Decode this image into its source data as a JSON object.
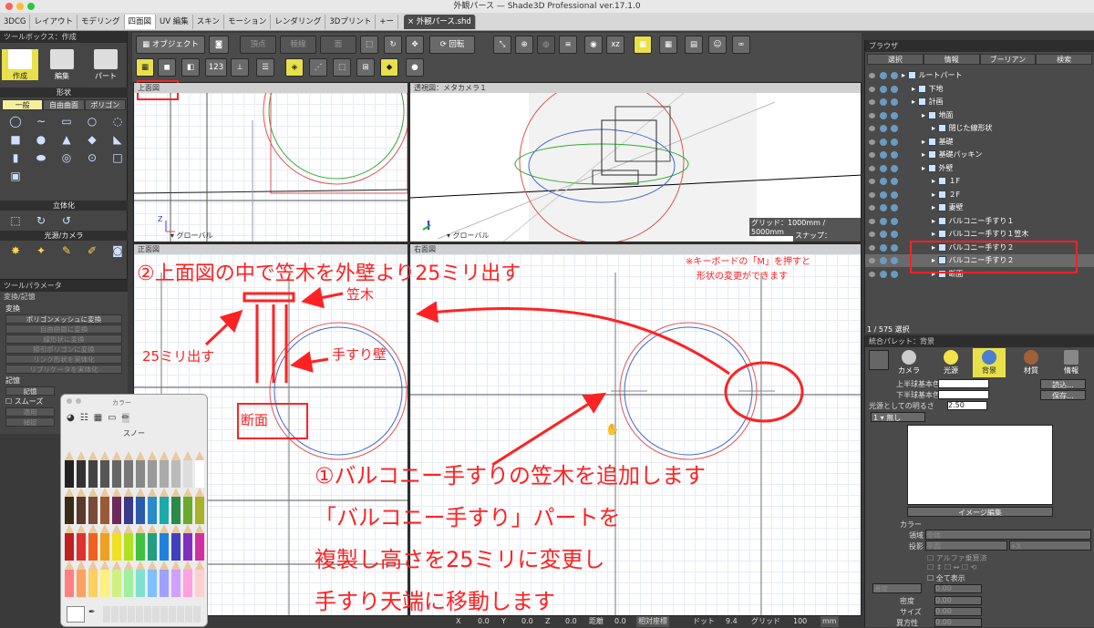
{
  "window_title": "外観パース — Shade3D Professional ver.17.1.0",
  "tabs": [
    "3DCG",
    "レイアウト",
    "モデリング",
    "四面図",
    "UV 編集",
    "スキン",
    "モーション",
    "レンダリング",
    "3Dプリント",
    "+ー"
  ],
  "active_tab_index": 3,
  "doc_tab": "× 外観パース.shd",
  "toolbox": {
    "title": "ツールボックス：作成",
    "modes": [
      "作成",
      "編集",
      "パート"
    ],
    "shape_header": "形状",
    "shape_tabs": [
      "一般",
      "自由曲面",
      "ポリゴン"
    ],
    "solid_header": "立体化",
    "light_header": "光源/カメラ"
  },
  "toolparam": {
    "title": "ツールパラメータ",
    "sub": "変換/記憶",
    "conv_label": "変換",
    "buttons": [
      "ポリゴンメッシュに変換",
      "自由曲面に変換",
      "線形状に変換",
      "掃引ポリゴンに変換",
      "リンク形状を実体化",
      "リプリケータを実体化"
    ],
    "memory_label": "記憶",
    "memory_btn": "記憶",
    "smooth": "スムーズ",
    "apply": "適用",
    "capture": "捕捉"
  },
  "toolbar": {
    "object": "オブジェクト",
    "vertex": "頂点",
    "edge": "稜線",
    "face": "面",
    "rotate": "回転"
  },
  "viewports": {
    "top": "上面図",
    "persp": "透視図：メタカメラ１",
    "front": "正面図",
    "right": "右面図",
    "global": "グローバル",
    "grid_info": "グリッド：1000mm / 5000mm",
    "snap_info": "スナップ：500mm",
    "axis_z": "Z",
    "axis_x": "X"
  },
  "browser": {
    "title": "ブラウザ",
    "tabs": [
      "選択",
      "情報",
      "ブーリアン",
      "検索"
    ],
    "tree": [
      {
        "label": "ルートパート",
        "depth": 0
      },
      {
        "label": "下地",
        "depth": 1
      },
      {
        "label": "計画",
        "depth": 1
      },
      {
        "label": "地面",
        "depth": 2
      },
      {
        "label": "閉じた線形状",
        "depth": 3
      },
      {
        "label": "基礎",
        "depth": 2
      },
      {
        "label": "基礎パッキン",
        "depth": 2
      },
      {
        "label": "外壁",
        "depth": 2
      },
      {
        "label": "１F",
        "depth": 3
      },
      {
        "label": "２F",
        "depth": 3
      },
      {
        "label": "妻壁",
        "depth": 3
      },
      {
        "label": "バルコニー手すり１",
        "depth": 3
      },
      {
        "label": "バルコニー手すり１笠木",
        "depth": 3
      },
      {
        "label": "バルコニー手すり２",
        "depth": 3
      },
      {
        "label": "バルコニー手すり２",
        "depth": 3
      },
      {
        "label": "断面",
        "depth": 3
      }
    ],
    "selection_count": "1 / 575 選択"
  },
  "palette": {
    "title": "統合パレット：背景",
    "tabs": [
      "カメラ",
      "光源",
      "背景",
      "材質",
      "情報"
    ],
    "upper": "上半球基本色",
    "lower": "下半球基本色",
    "load": "読込...",
    "save": "保存...",
    "brightness_label": "光源としての明るさ",
    "brightness": "2.50",
    "none": "無し",
    "image_edit": "イメージ編集",
    "color": "カラー",
    "area": "領域",
    "area_val": "全体",
    "projection": "投影",
    "proj_val": "平面",
    "proj_axis": "+X",
    "alpha": "アルファ乗算済",
    "show_all": "全て表示",
    "normal": "通常",
    "density": "密度",
    "size": "サイズ",
    "ratio": "異方性",
    "zero": "0.00"
  },
  "status": {
    "x_label": "X",
    "x": "0.0",
    "y_label": "Y",
    "y": "0.0",
    "z_label": "Z",
    "z": "0.0",
    "dist_label": "距離",
    "dist": "0.0",
    "coord": "相対座標",
    "dot_label": "ドット",
    "dot": "9.4",
    "grid_label": "グリッド",
    "grid": "100",
    "unit": "mm"
  },
  "picker": {
    "title": "カラー",
    "name": "スノー"
  },
  "annotations": {
    "headline": "②上面図の中で笠木を外壁より25ミリ出す",
    "kasagi": "笠木",
    "protrude": "25ミリ出す",
    "wall": "手すり壁",
    "section": "断面",
    "note1": "※キーボードの「M」を押すと",
    "note2": "形状の変更ができます",
    "step1": "①バルコニー手すりの笠木を追加します",
    "step2": "「バルコニー手すり」パートを",
    "step3": "複製し高さを25ミリに変更し",
    "step4": "手すり天端に移動します"
  },
  "colors": {
    "accent_red": "#ff2222",
    "highlight_yellow": "#e8e04a"
  }
}
